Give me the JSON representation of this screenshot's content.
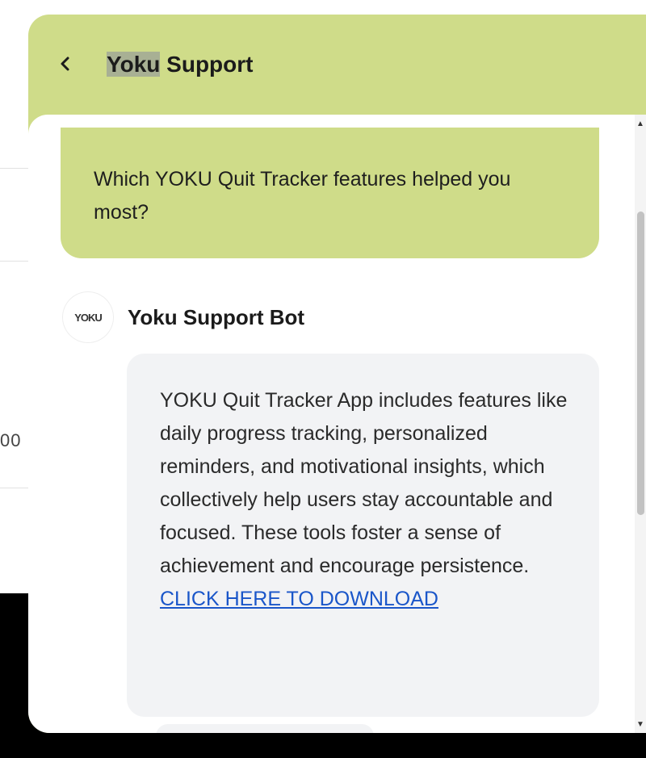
{
  "background": {
    "fragment_text": "00"
  },
  "header": {
    "back_icon": "chevron-left-icon",
    "title_highlight": "Yoku",
    "title_rest": " Support"
  },
  "messages": {
    "user": {
      "text": "Which YOKU Quit Tracker features helped you most?"
    },
    "bot": {
      "avatar_text": "YOKU",
      "name": "Yoku Support Bot",
      "text": "YOKU Quit Tracker App includes features like daily progress tracking, personalized reminders, and motivational insights, which collectively help users stay accountable and focused. These tools foster a sense of achievement and encourage persistence.",
      "link_text": "CLICK HERE TO DOWNLOAD"
    }
  },
  "scrollbar": {
    "up_icon": "▲",
    "down_icon": "▼"
  },
  "colors": {
    "accent": "#cfdc89",
    "bot_bubble": "#f2f3f5",
    "link": "#1a56c9",
    "backdrop": "#000000"
  }
}
